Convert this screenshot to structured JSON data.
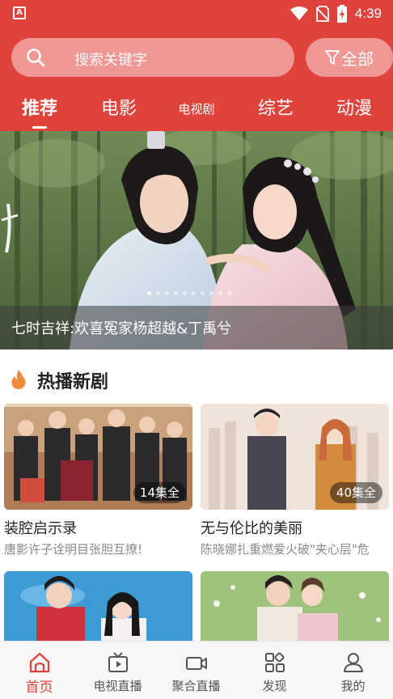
{
  "status_bar": {
    "time": "4:39",
    "app_icon_letter": "A"
  },
  "search": {
    "placeholder": "搜索关键字",
    "filter_label": "全部"
  },
  "tabs": [
    {
      "label": "推荐",
      "active": true
    },
    {
      "label": "电影",
      "active": false
    },
    {
      "label": "电视剧",
      "active": false
    },
    {
      "label": "综艺",
      "active": false
    },
    {
      "label": "动漫",
      "active": false
    }
  ],
  "banner": {
    "caption": "七时吉祥:欢喜冤家杨超越&丁禹兮",
    "title_glyph": "祥",
    "dot_count": 10,
    "active_dot": 0
  },
  "section": {
    "title": "热播新剧",
    "icon": "fire-icon"
  },
  "cards": [
    {
      "title": "装腔启示录",
      "desc": "唐影许子诠明目张胆互撩!",
      "badge": "14集全"
    },
    {
      "title": "无与伦比的美丽",
      "desc": "陈晓娜扎重燃爱火破\"夹心层\"危",
      "badge": "40集全"
    },
    {
      "title": "",
      "desc": "",
      "badge": ""
    },
    {
      "title": "",
      "desc": "",
      "badge": ""
    }
  ],
  "bottom_nav": [
    {
      "label": "首页",
      "icon": "home-icon",
      "active": true
    },
    {
      "label": "电视直播",
      "icon": "tv-icon",
      "active": false
    },
    {
      "label": "聚合直播",
      "icon": "camera-icon",
      "active": false
    },
    {
      "label": "发现",
      "icon": "discover-icon",
      "active": false
    },
    {
      "label": "我的",
      "icon": "user-icon",
      "active": false
    }
  ],
  "colors": {
    "accent": "#e0423c",
    "text": "#222222",
    "muted": "#8a8a8a"
  }
}
